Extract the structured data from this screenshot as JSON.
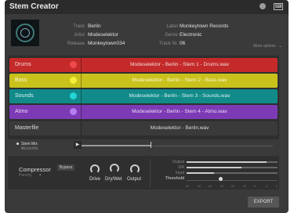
{
  "window": {
    "title": "Stem Creator"
  },
  "meta": {
    "track_label": "Track",
    "track": "Berlin",
    "artist_label": "Artist",
    "artist": "Modeselektor",
    "release_label": "Release",
    "release": "Monkeytown034",
    "label_label": "Label",
    "label": "Monkeytown Records",
    "genre_label": "Genre",
    "genre": "Electronic",
    "trackno_label": "Track Nr.",
    "trackno": "06",
    "more_options": "More options"
  },
  "stems": [
    {
      "name": "Drums",
      "file": "Modeselektor - Berlin - Stem 1 - Drums.wav",
      "color": "#c42a2a",
      "dot": "#f14a4a",
      "text": "#f3dada"
    },
    {
      "name": "Bass",
      "file": "Modeselektor - Berlin - Stem 2 - Bass.wav",
      "color": "#c9c21d",
      "dot": "#f4ef3a",
      "text": "#fbf8d0"
    },
    {
      "name": "Sounds",
      "file": "Modeselektor - Berlin - Stem 3 - Sounds.wav",
      "color": "#128a8a",
      "dot": "#22d6d6",
      "text": "#d8f3f3"
    },
    {
      "name": "Atmo",
      "file": "Modeselektor - Berlin - Stem 4 - Atmo.wav",
      "color": "#7d3ab5",
      "dot": "#b57ef0",
      "text": "#eadbf7"
    }
  ],
  "master": {
    "name": "Masterfile",
    "file": "Modeselektor - Berlin.wav"
  },
  "player": {
    "stem_mix": "Stem Mix",
    "master_mix": "Masterfile",
    "progress": 0.36
  },
  "compressor": {
    "title": "Compressor",
    "bypass": "Bypass",
    "sub": "Punchy",
    "knobs": [
      "Drive",
      "Dry/Wet",
      "Output"
    ],
    "meters": [
      {
        "label": "Output",
        "level": 0.88
      },
      {
        "label": "GR",
        "level": 0.6
      },
      {
        "label": "Input",
        "level": 0.3
      }
    ],
    "threshold_label": "Threshold",
    "threshold": 0.37,
    "scale": [
      "-60",
      "-50",
      "-40",
      "-30",
      "-20",
      "-10",
      "-6",
      "-3",
      "0"
    ]
  },
  "actions": {
    "export": "EXPORT"
  }
}
